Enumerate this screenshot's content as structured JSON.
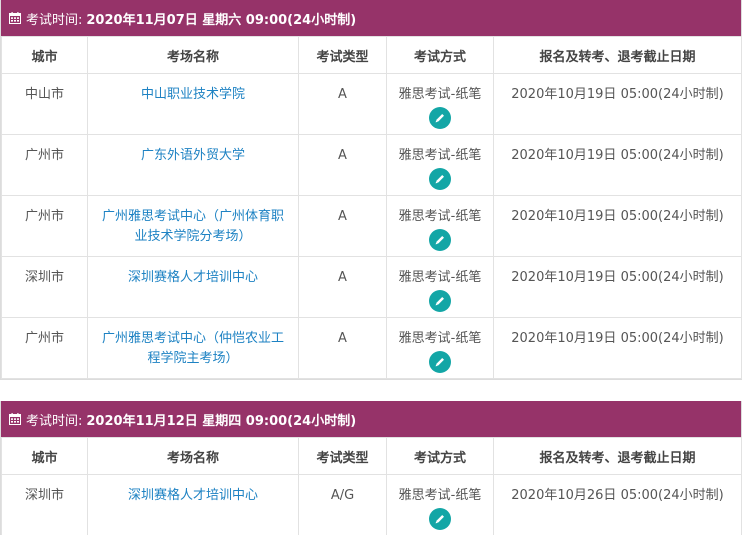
{
  "sections": [
    {
      "header_label": "考试时间:",
      "header_value": "2020年11月07日 星期六 09:00(24小时制)",
      "columns": [
        "城市",
        "考场名称",
        "考试类型",
        "考试方式",
        "报名及转考、退考截止日期"
      ],
      "rows": [
        {
          "city": "中山市",
          "venue": "中山职业技术学院",
          "type": "A",
          "method": "雅思考试-纸笔",
          "deadline": "2020年10月19日 05:00(24小时制)"
        },
        {
          "city": "广州市",
          "venue": "广东外语外贸大学",
          "type": "A",
          "method": "雅思考试-纸笔",
          "deadline": "2020年10月19日 05:00(24小时制)"
        },
        {
          "city": "广州市",
          "venue": "广州雅思考试中心（广州体育职业技术学院分考场）",
          "type": "A",
          "method": "雅思考试-纸笔",
          "deadline": "2020年10月19日 05:00(24小时制)"
        },
        {
          "city": "深圳市",
          "venue": "深圳赛格人才培训中心",
          "type": "A",
          "method": "雅思考试-纸笔",
          "deadline": "2020年10月19日 05:00(24小时制)"
        },
        {
          "city": "广州市",
          "venue": "广州雅思考试中心（仲恺农业工程学院主考场）",
          "type": "A",
          "method": "雅思考试-纸笔",
          "deadline": "2020年10月19日 05:00(24小时制)"
        }
      ]
    },
    {
      "header_label": "考试时间:",
      "header_value": "2020年11月12日 星期四 09:00(24小时制)",
      "columns": [
        "城市",
        "考场名称",
        "考试类型",
        "考试方式",
        "报名及转考、退考截止日期"
      ],
      "rows": [
        {
          "city": "深圳市",
          "venue": "深圳赛格人才培训中心",
          "type": "A/G",
          "method": "雅思考试-纸笔",
          "deadline": "2020年10月26日 05:00(24小时制)"
        }
      ]
    }
  ],
  "colors": {
    "header_bg": "#963369",
    "link": "#1d82c3",
    "edit_button": "#13a6a6"
  },
  "icons": {
    "header": "calendar-icon",
    "row_action": "pencil-icon"
  }
}
